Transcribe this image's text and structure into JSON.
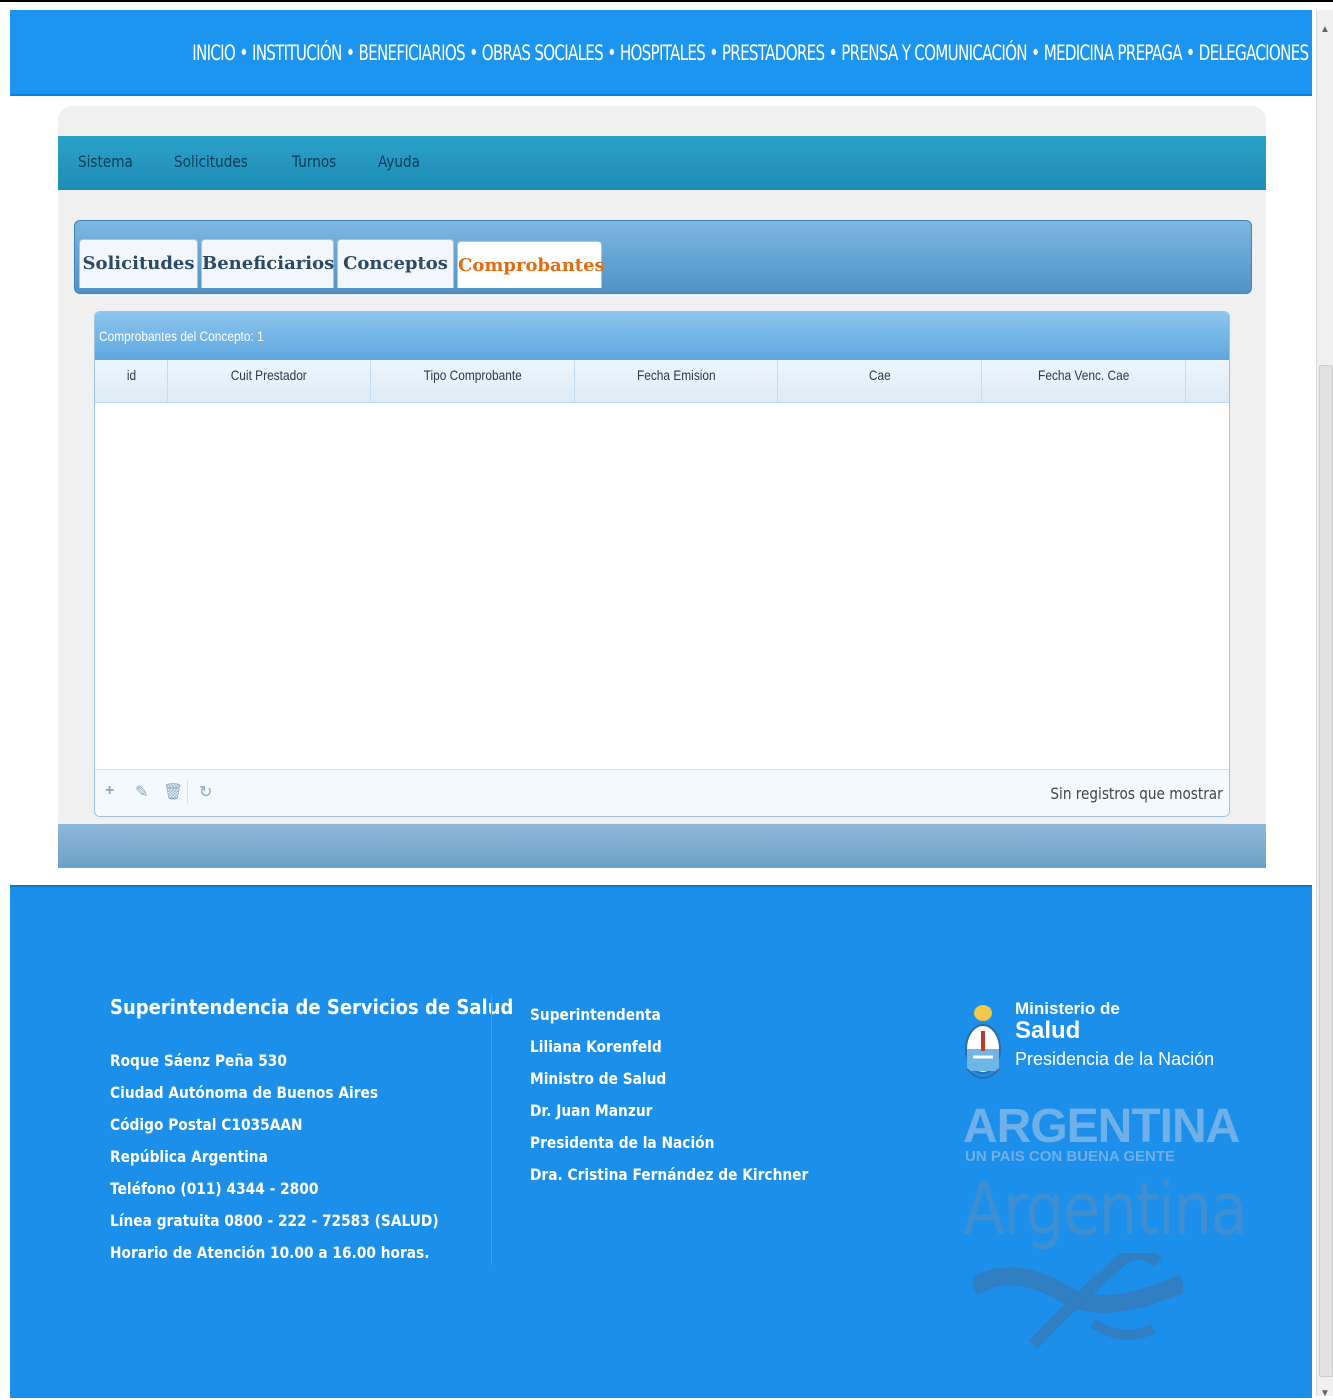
{
  "top_nav": {
    "items": [
      "INICIO",
      "INSTITUCIÓN",
      "BENEFICIARIOS",
      "OBRAS SOCIALES",
      "HOSPITALES",
      "PRESTADORES",
      "PRENSA Y COMUNICACIÓN",
      "MEDICINA PREPAGA",
      "DELEGACIONES"
    ],
    "separator": "•"
  },
  "menu": {
    "items": [
      "Sistema",
      "Solicitudes",
      "Turnos",
      "Ayuda"
    ]
  },
  "tabs": {
    "items": [
      "Solicitudes",
      "Beneficiarios",
      "Conceptos",
      "Comprobantes"
    ],
    "active": "Comprobantes"
  },
  "grid": {
    "caption": "Comprobantes del Concepto: 1",
    "columns": [
      "id",
      "Cuit Prestador",
      "Tipo Comprobante",
      "Fecha Emision",
      "Cae",
      "Fecha Venc. Cae"
    ],
    "rows": [],
    "status": "Sin registros que mostrar",
    "pager_icons": [
      "add-icon",
      "edit-icon",
      "delete-icon",
      "refresh-icon"
    ]
  },
  "footer": {
    "org_title": "Superintendencia de Servicios de Salud",
    "address_lines": [
      "Roque Sáenz Peña 530",
      "Ciudad Autónoma de Buenos Aires",
      "Código Postal C1035AAN",
      "República Argentina",
      "Teléfono (011) 4344 - 2800",
      "Línea gratuita 0800 - 222 - 72583 (SALUD)",
      "Horario de Atención 10.00 a 16.00 horas."
    ],
    "officials": [
      "Superintendenta",
      "Liliana Korenfeld",
      "Ministro de Salud",
      "Dr. Juan Manzur",
      "Presidenta de la Nación",
      "Dra. Cristina Fernández de Kirchner"
    ],
    "ministry": {
      "line1": "Ministerio de",
      "line2": "Salud",
      "line3": "Presidencia de la Nación"
    },
    "brand": {
      "big": "ARGENTINA",
      "tagline": "UN PAIS CON BUENA GENTE",
      "script": "Argentina"
    }
  },
  "colors": {
    "nav_blue": "#1b95f0",
    "menu_teal": "#1e8db5",
    "active_tab_orange": "#e16c12",
    "footer_blue": "#1b8fe9"
  }
}
